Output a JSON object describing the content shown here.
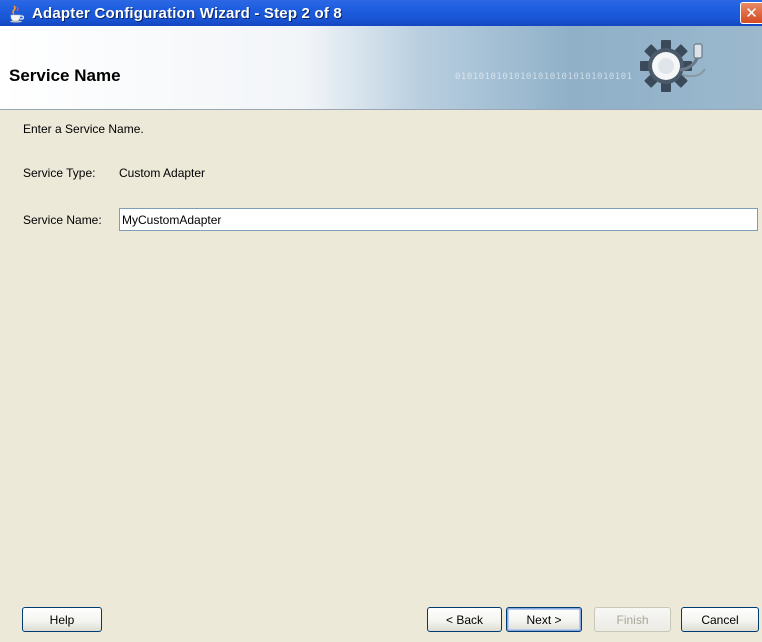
{
  "window": {
    "title": "Adapter Configuration Wizard - Step 2 of 8",
    "close_label": "✕"
  },
  "banner": {
    "title": "Service Name",
    "binary_text": "010101010101010101010101010101"
  },
  "content": {
    "instruction": "Enter a Service Name.",
    "service_type_label": "Service Type:",
    "service_type_value": "Custom Adapter",
    "service_name_label": "Service Name:",
    "service_name_value": "MyCustomAdapter"
  },
  "buttons": {
    "help": "Help",
    "back": "< Back",
    "next": "Next >",
    "finish": "Finish",
    "cancel": "Cancel"
  },
  "icons": {
    "app": "java-cup-icon",
    "banner": "gear-plug-icon",
    "close": "close-icon"
  },
  "colors": {
    "titlebar": "#1f5fe0",
    "window_bg": "#ece9d8",
    "close_button": "#d54a22"
  }
}
